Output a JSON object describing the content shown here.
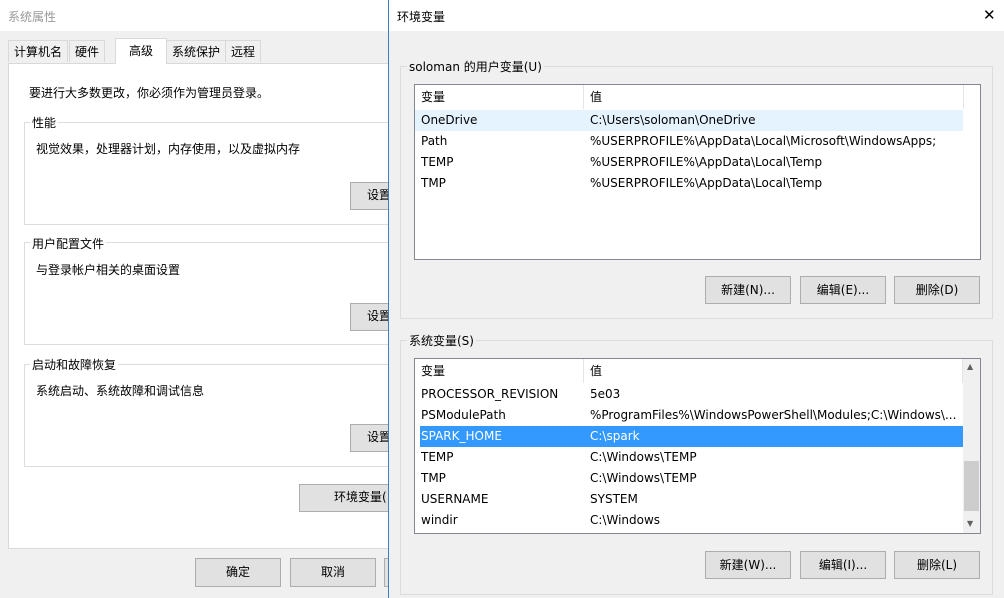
{
  "sysprops": {
    "title": "系统属性",
    "tabs": [
      "计算机名",
      "硬件",
      "高级",
      "系统保护",
      "远程"
    ],
    "admin_note": "要进行大多数更改，你必须作为管理员登录。",
    "performance": {
      "label": "性能",
      "desc": "视觉效果，处理器计划，内存使用，以及虚拟内存",
      "button": "设置"
    },
    "profiles": {
      "label": "用户配置文件",
      "desc": "与登录帐户相关的桌面设置",
      "button": "设置"
    },
    "startup": {
      "label": "启动和故障恢复",
      "desc": "系统启动、系统故障和调试信息",
      "button": "设置"
    },
    "env_button": "环境变量(",
    "ok": "确定",
    "cancel": "取消"
  },
  "envwin": {
    "title": "环境变量",
    "close_glyph": "✕",
    "user_group_label": "soloman 的用户变量(U)",
    "col_var": "变量",
    "col_val": "值",
    "user_vars": [
      {
        "name": "OneDrive",
        "value": "C:\\Users\\soloman\\OneDrive"
      },
      {
        "name": "Path",
        "value": "%USERPROFILE%\\AppData\\Local\\Microsoft\\WindowsApps;"
      },
      {
        "name": "TEMP",
        "value": "%USERPROFILE%\\AppData\\Local\\Temp"
      },
      {
        "name": "TMP",
        "value": "%USERPROFILE%\\AppData\\Local\\Temp"
      }
    ],
    "user_buttons": {
      "new": "新建(N)...",
      "edit": "编辑(E)...",
      "delete": "删除(D)"
    },
    "sys_group_label": "系统变量(S)",
    "sys_vars": [
      {
        "name": "PROCESSOR_REVISION",
        "value": "5e03"
      },
      {
        "name": "PSModulePath",
        "value": "%ProgramFiles%\\WindowsPowerShell\\Modules;C:\\Windows\\..."
      },
      {
        "name": "SPARK_HOME",
        "value": "C:\\spark"
      },
      {
        "name": "TEMP",
        "value": "C:\\Windows\\TEMP"
      },
      {
        "name": "TMP",
        "value": "C:\\Windows\\TEMP"
      },
      {
        "name": "USERNAME",
        "value": "SYSTEM"
      },
      {
        "name": "windir",
        "value": "C:\\Windows"
      }
    ],
    "sys_buttons": {
      "new": "新建(W)...",
      "edit": "编辑(I)...",
      "delete": "删除(L)"
    },
    "scroll_up_glyph": "▲",
    "scroll_down_glyph": "▼"
  },
  "colors": {
    "selection": "#3399ff",
    "hover": "#e5f3ff",
    "window_border": "#3a7dc9"
  }
}
